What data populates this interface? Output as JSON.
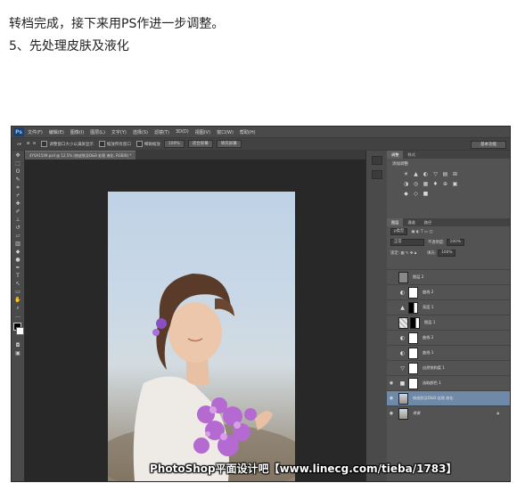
{
  "article": {
    "line1": "转档完成，接下来用PS作进一步调整。",
    "line2": "5、先处理皮肤及液化"
  },
  "app": {
    "logo": "Ps",
    "menus": [
      "文件(F)",
      "编辑(E)",
      "图像(I)",
      "图层(L)",
      "文字(Y)",
      "选择(S)",
      "滤镜(T)",
      "3D(D)",
      "视图(V)",
      "窗口(W)",
      "帮助(H)"
    ],
    "options": {
      "chk1_label": "调整窗口大小以满屏显示",
      "chk2_label": "缩放所有窗口",
      "chk3_label": "细微缩放",
      "btn_100": "100%",
      "btn_fit": "适合屏幕",
      "btn_fill": "填充屏幕",
      "workspace": "基本功能"
    },
    "document_tab": "4Y0A1549.psd @ 12.5% (修皮肤及D&B 处理 液化, RGB/8) *"
  },
  "panels": {
    "top_tabs": [
      "调整",
      "样式"
    ],
    "adjust_heading": "添加调整",
    "adjust_icons": [
      "☀",
      "▲",
      "◐",
      "▽",
      "▤",
      "⊞",
      "◑",
      "◎",
      "▦",
      "♦",
      "⊕",
      "▣",
      "◆",
      "◇",
      "■"
    ],
    "layers_tabs": [
      "图层",
      "通道",
      "路径"
    ],
    "kind_filter": "ρ类型",
    "blend_mode": "正常",
    "opacity_label": "不透明度:",
    "opacity_value": "100%",
    "lock_label": "锁定:",
    "fill_label": "填充:",
    "fill_value": "100%"
  },
  "layers": [
    {
      "name": "图层 2",
      "type": "pixel",
      "visible": false,
      "selected": false
    },
    {
      "name": "曲线 2",
      "type": "curves",
      "visible": false,
      "selected": false
    },
    {
      "name": "亮度 1",
      "type": "levels",
      "visible": false,
      "selected": false
    },
    {
      "name": "图层 1",
      "type": "pixel",
      "visible": false,
      "selected": false
    },
    {
      "name": "曲线 2",
      "type": "curves",
      "visible": false,
      "selected": false
    },
    {
      "name": "曲线 1",
      "type": "curves",
      "visible": false,
      "selected": false
    },
    {
      "name": "自然饱和度 1",
      "type": "vibrance",
      "visible": false,
      "selected": false
    },
    {
      "name": "选取颜色 1",
      "type": "selective",
      "visible": true,
      "selected": false
    },
    {
      "name": "修皮肤及D&B 处理 液化",
      "type": "photo",
      "visible": true,
      "selected": true
    },
    {
      "name": "背景",
      "type": "photo",
      "visible": true,
      "selected": false
    }
  ],
  "watermark": "PhotoShop平面设计吧【www.linecg.com/tieba/1783】"
}
